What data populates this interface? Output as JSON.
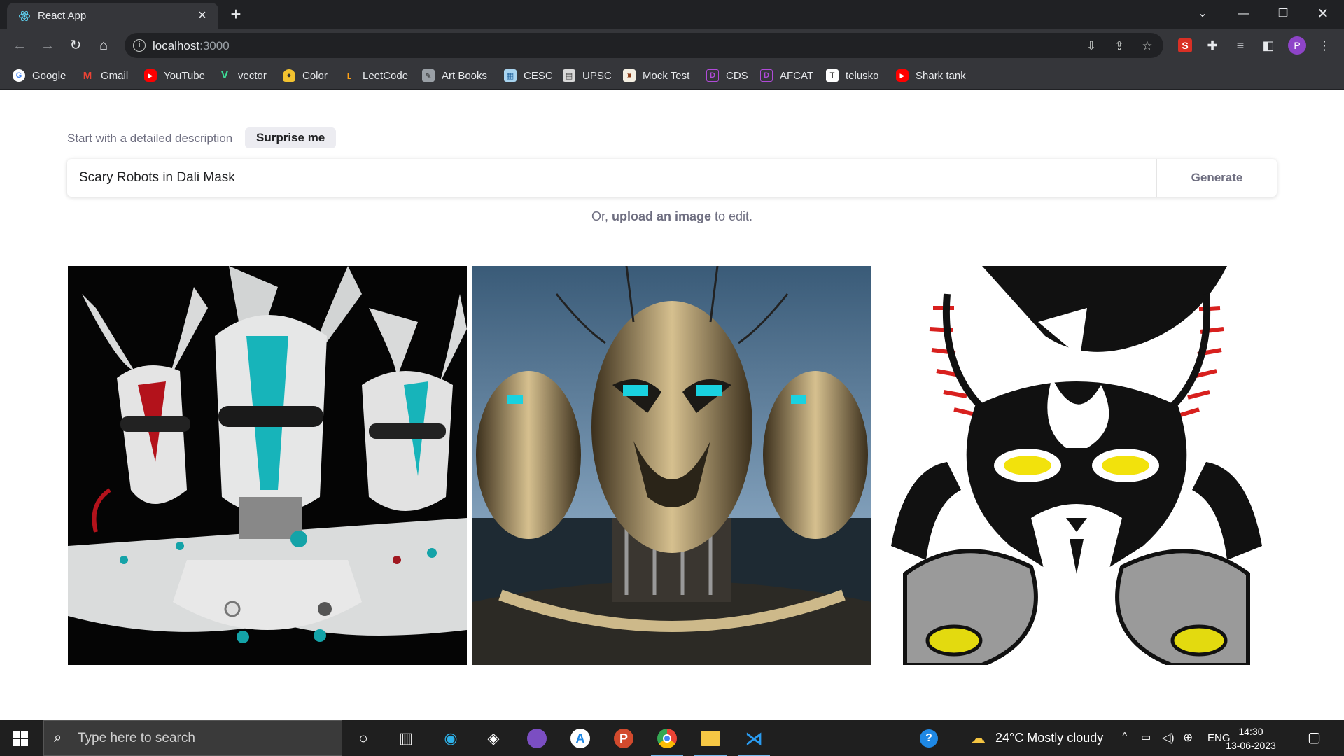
{
  "browser": {
    "tab_title": "React App",
    "url_host": "localhost",
    "url_port": ":3000",
    "bookmarks": [
      "Google",
      "Gmail",
      "YouTube",
      "vector",
      "Color",
      "LeetCode",
      "Art Books",
      "CESC",
      "UPSC",
      "Mock Test",
      "CDS",
      "AFCAT",
      "telusko",
      "Shark tank"
    ],
    "profile_initial": "P",
    "extension_letter": "S"
  },
  "app": {
    "prompt_label": "Start with a detailed description",
    "surprise_label": "Surprise me",
    "prompt_value": "Scary Robots in Dali Mask",
    "generate_label": "Generate",
    "upload_prefix": "Or,",
    "upload_link": "upload an image",
    "upload_suffix": "to edit."
  },
  "taskbar": {
    "search_placeholder": "Type here to search",
    "weather": "24°C  Mostly cloudy",
    "language": "ENG",
    "time": "14:30",
    "date": "13-06-2023"
  }
}
